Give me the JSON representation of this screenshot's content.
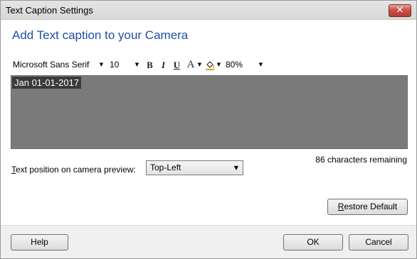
{
  "window": {
    "title": "Text Caption Settings",
    "close_glyph": "✕"
  },
  "heading": "Add Text caption to your Camera",
  "toolbar": {
    "font_family": "Microsoft Sans Serif",
    "font_size": "10",
    "bold_label": "B",
    "italic_label": "I",
    "underline_label": "U",
    "font_color_label": "A",
    "fill_color_icon": "paint-bucket-icon",
    "opacity": "80%"
  },
  "caption": {
    "text": "Jan 01-01-2017",
    "remaining": "86 characters remaining"
  },
  "position": {
    "label_prefix": "T",
    "label_rest": "ext position on camera preview:",
    "selected": "Top-Left"
  },
  "buttons": {
    "restore_prefix": "R",
    "restore_rest": "estore Default",
    "help": "Help",
    "ok": "OK",
    "cancel": "Cancel"
  },
  "colors": {
    "heading": "#1f4fa8",
    "caption_background": "#7a7a7a",
    "close_button": "#c75050"
  }
}
